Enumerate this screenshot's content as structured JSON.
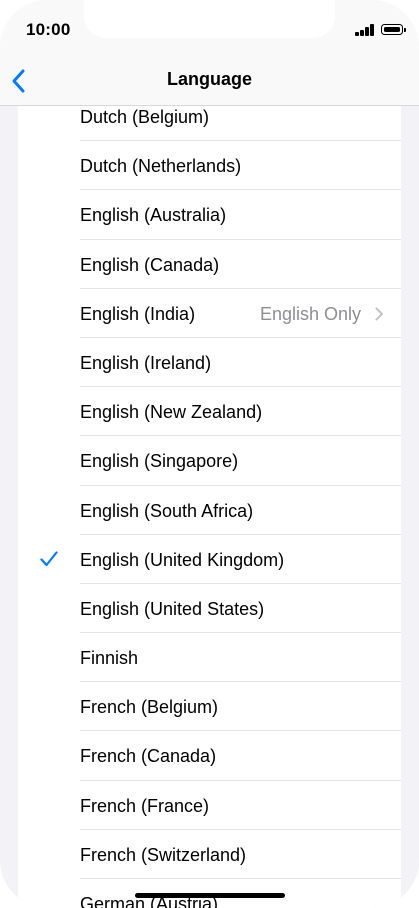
{
  "status_bar": {
    "time": "10:00"
  },
  "nav": {
    "title": "Language",
    "back_icon": "chevron-left-icon"
  },
  "colors": {
    "accent": "#007aff",
    "background": "#f2f2f7",
    "secondary_text": "#8e8e93"
  },
  "languages": [
    {
      "label": "Dutch (Belgium)",
      "selected": false,
      "detail": ""
    },
    {
      "label": "Dutch (Netherlands)",
      "selected": false,
      "detail": ""
    },
    {
      "label": "English (Australia)",
      "selected": false,
      "detail": ""
    },
    {
      "label": "English (Canada)",
      "selected": false,
      "detail": ""
    },
    {
      "label": "English (India)",
      "selected": false,
      "detail": "English Only"
    },
    {
      "label": "English (Ireland)",
      "selected": false,
      "detail": ""
    },
    {
      "label": "English (New Zealand)",
      "selected": false,
      "detail": ""
    },
    {
      "label": "English (Singapore)",
      "selected": false,
      "detail": ""
    },
    {
      "label": "English (South Africa)",
      "selected": false,
      "detail": ""
    },
    {
      "label": "English (United Kingdom)",
      "selected": true,
      "detail": ""
    },
    {
      "label": "English (United States)",
      "selected": false,
      "detail": ""
    },
    {
      "label": "Finnish",
      "selected": false,
      "detail": ""
    },
    {
      "label": "French (Belgium)",
      "selected": false,
      "detail": ""
    },
    {
      "label": "French (Canada)",
      "selected": false,
      "detail": ""
    },
    {
      "label": "French (France)",
      "selected": false,
      "detail": ""
    },
    {
      "label": "French (Switzerland)",
      "selected": false,
      "detail": ""
    },
    {
      "label": "German (Austria)",
      "selected": false,
      "detail": ""
    }
  ]
}
